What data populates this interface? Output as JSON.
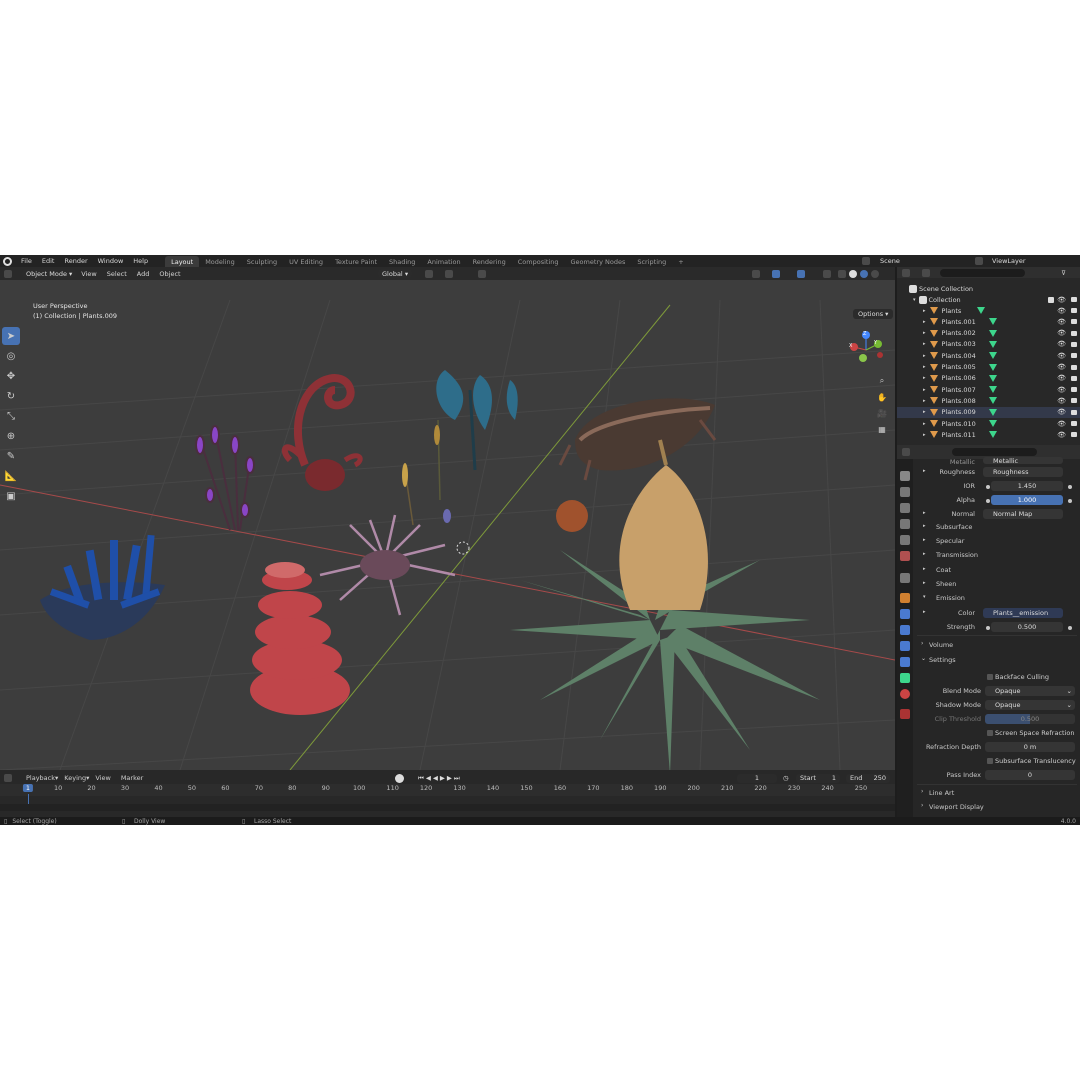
{
  "menu": [
    "File",
    "Edit",
    "Render",
    "Window",
    "Help"
  ],
  "workspaces": [
    "Layout",
    "Modeling",
    "Sculpting",
    "UV Editing",
    "Texture Paint",
    "Shading",
    "Animation",
    "Rendering",
    "Compositing",
    "Geometry Nodes",
    "Scripting"
  ],
  "add_tab": "+",
  "scene_name": "Scene",
  "view_layer": "ViewLayer",
  "header": {
    "mode": "Object Mode",
    "menus": [
      "View",
      "Select",
      "Add",
      "Object"
    ],
    "orientation": "Global",
    "options": "Options"
  },
  "viewport": {
    "line1": "User Perspective",
    "line2": "(1) Collection | Plants.009",
    "axes": [
      "X",
      "Y",
      "Z"
    ]
  },
  "outliner": {
    "root": "Scene Collection",
    "collection": "Collection",
    "items": [
      "Plants",
      "Plants.001",
      "Plants.002",
      "Plants.003",
      "Plants.004",
      "Plants.005",
      "Plants.006",
      "Plants.007",
      "Plants.008",
      "Plants.009",
      "Plants.010",
      "Plants.011"
    ]
  },
  "properties": {
    "metallic_label": "Metallic",
    "metallic_value": "Metallic",
    "roughness_label": "Roughness",
    "roughness_value": "Roughness",
    "ior_label": "IOR",
    "ior_value": "1.450",
    "alpha_label": "Alpha",
    "alpha_value": "1.000",
    "normal_label": "Normal",
    "normal_value": "Normal Map",
    "sections": [
      "Subsurface",
      "Specular",
      "Transmission",
      "Coat",
      "Sheen",
      "Emission"
    ],
    "color_label": "Color",
    "color_value": "Plants__emission",
    "strength_label": "Strength",
    "strength_value": "0.500",
    "volume": "Volume",
    "settings": "Settings",
    "backface": "Backface Culling",
    "blend_label": "Blend Mode",
    "blend_value": "Opaque",
    "shadow_label": "Shadow Mode",
    "shadow_value": "Opaque",
    "clip_label": "Clip Threshold",
    "clip_value": "0.500",
    "ssr": "Screen Space Refraction",
    "refr_label": "Refraction Depth",
    "refr_value": "0 m",
    "sst": "Subsurface Translucency",
    "pass_label": "Pass Index",
    "pass_value": "0",
    "lineart": "Line Art",
    "viewport_display": "Viewport Display"
  },
  "timeline": {
    "menus": [
      "Playback",
      "Keying",
      "View",
      "Marker"
    ],
    "current_frame": "1",
    "start_label": "Start",
    "start_value": "1",
    "end_label": "End",
    "end_value": "250",
    "ruler": [
      "1",
      "10",
      "20",
      "30",
      "40",
      "50",
      "60",
      "70",
      "80",
      "90",
      "100",
      "110",
      "120",
      "130",
      "140",
      "150",
      "160",
      "170",
      "180",
      "190",
      "200",
      "210",
      "220",
      "230",
      "240",
      "250"
    ]
  },
  "status": {
    "select": "Select (Toggle)",
    "dolly": "Dolly View",
    "lasso": "Lasso Select",
    "version": "4.0.0"
  },
  "colors": {
    "accent": "#4772b3",
    "bg": "#1d1d1d",
    "viewport": "#3d3d3d",
    "object_icon": "#e09a4b",
    "mesh_icon": "#3dd68c"
  }
}
